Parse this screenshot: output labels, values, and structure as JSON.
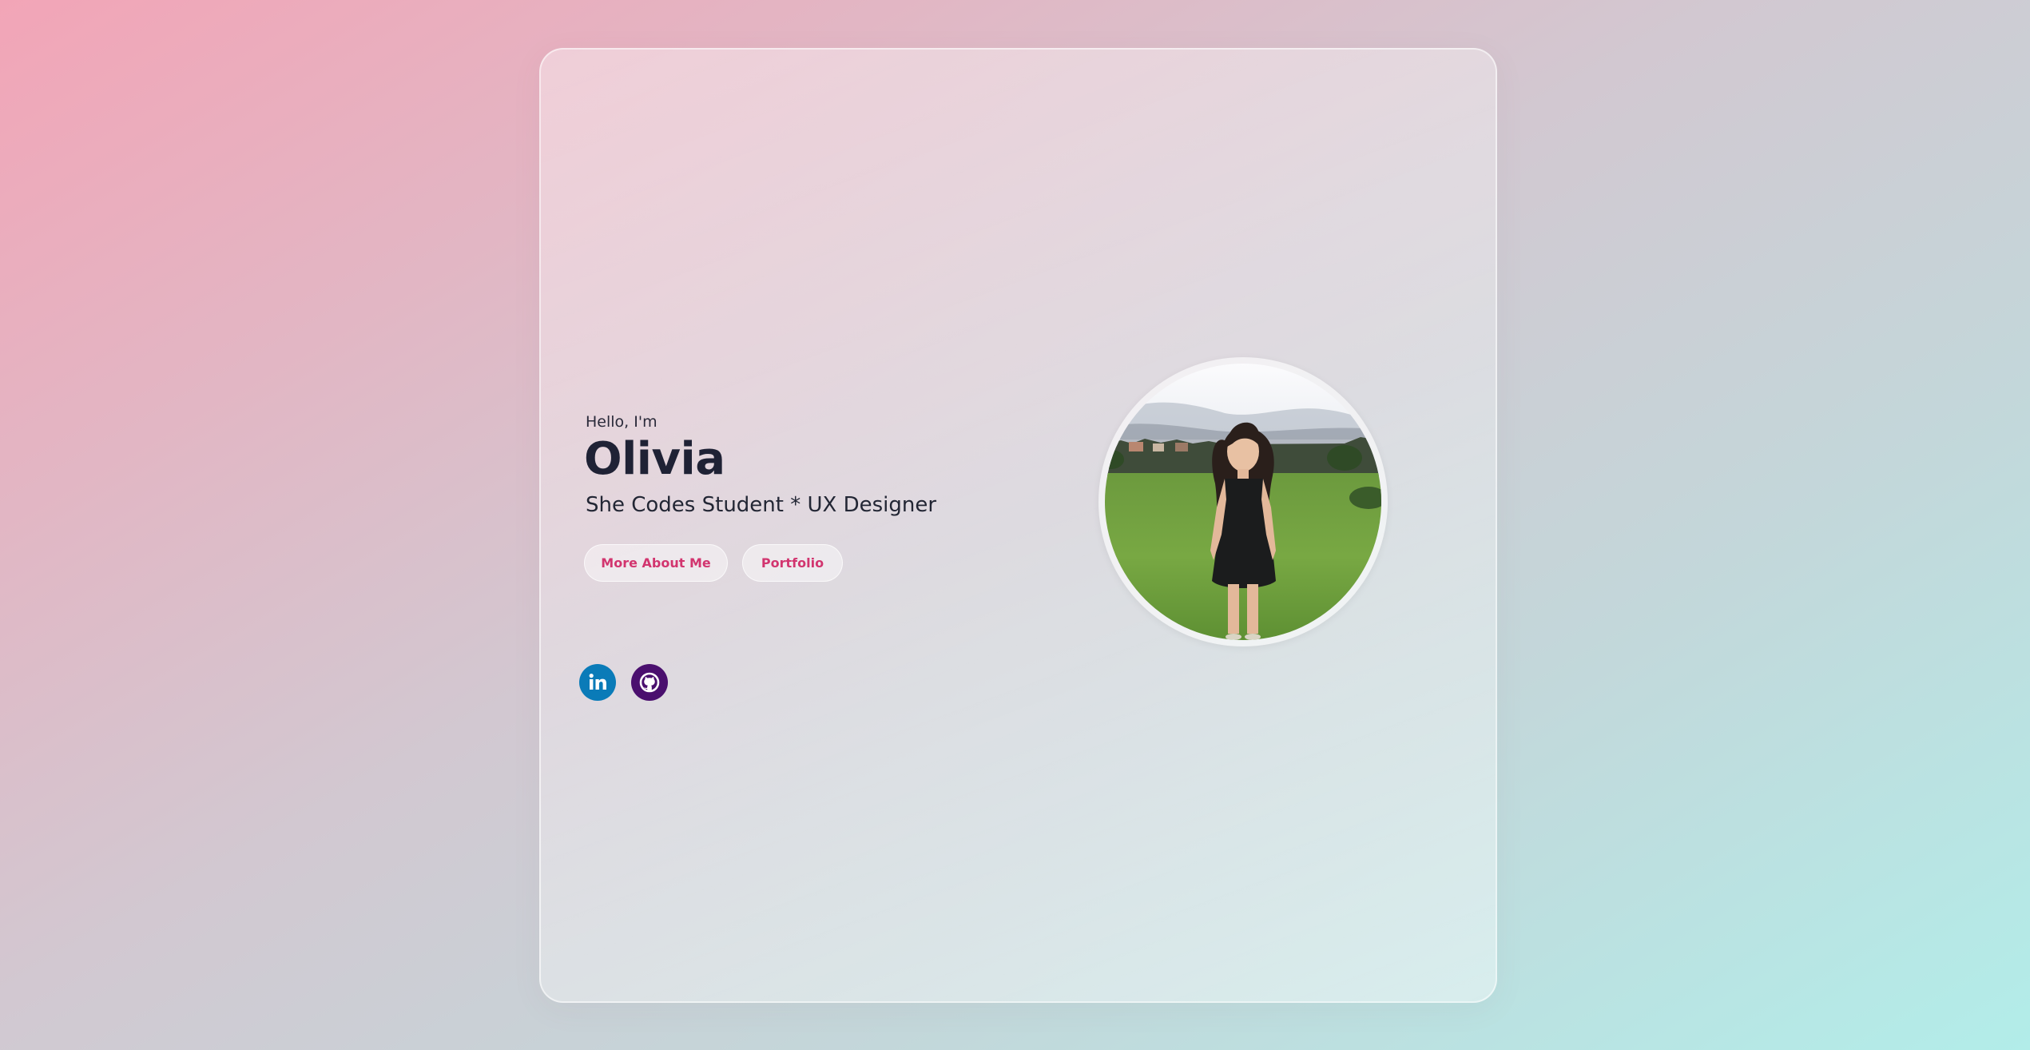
{
  "hero": {
    "greeting": "Hello, I'm",
    "name": "Olivia",
    "tagline": "She Codes Student * UX Designer"
  },
  "buttons": {
    "more_about_me": "More About Me",
    "portfolio": "Portfolio"
  },
  "social": [
    {
      "name": "linkedin",
      "icon": "linkedin-icon",
      "color": "#0a7bb8"
    },
    {
      "name": "github",
      "icon": "github-icon",
      "color": "#4a0f6e"
    }
  ],
  "colors": {
    "accent": "#d2356f",
    "heading": "#1f2235",
    "background_start": "#f2a5b7",
    "background_end": "#b2ede9"
  }
}
